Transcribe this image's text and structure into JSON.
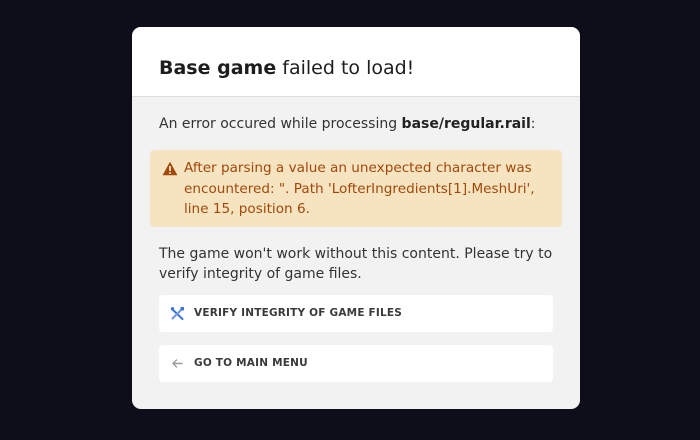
{
  "dialog": {
    "title_bold": "Base game",
    "title_rest": " failed to load!",
    "intro_prefix": "An error occured while processing ",
    "intro_file": "base/regular.rail",
    "intro_suffix": ":",
    "error_message": "After parsing a value an unexpected character was encountered: \". Path 'LofterIngredients[1].MeshUri', line 15, position 6.",
    "info_text": "The game won't work without this content. Please try to verify integrity of game files.",
    "buttons": {
      "verify_label": "VERIFY INTEGRITY OF GAME FILES",
      "menu_label": "GO TO MAIN MENU"
    }
  },
  "icons": {
    "warning": "warning-icon",
    "verify": "tools-icon",
    "back": "arrow-left-icon"
  },
  "colors": {
    "background": "#0e0e1a",
    "dialog": "#f2f2f2",
    "error_bg": "#f6e3bf",
    "error_text": "#a1480c",
    "accent_blue": "#3b74d8"
  }
}
